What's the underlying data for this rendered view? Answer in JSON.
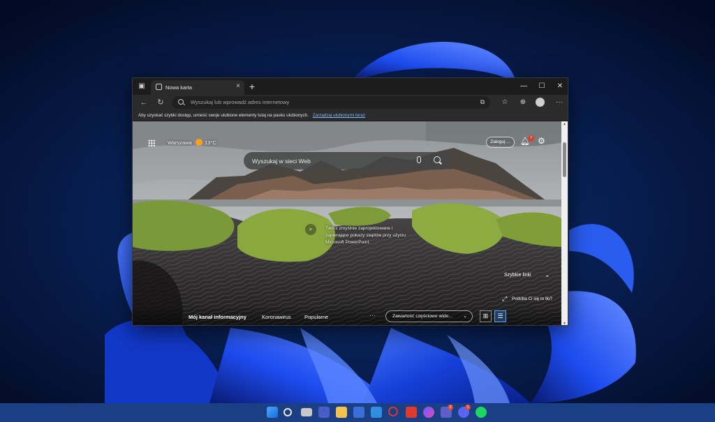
{
  "browser": {
    "tab_title": "Nowa karta",
    "address_placeholder": "Wyszukaj lub wprowadź adres internetowy",
    "favorites_bar": {
      "message": "Aby uzyskać szybki dostęp, umieść swoje ulubione elementy tutaj na pasku ulubionych.",
      "link": "Zarządzaj ulubionymi teraz"
    }
  },
  "new_tab_page": {
    "weather": {
      "city": "Warszawa",
      "temperature": "13°C"
    },
    "login_button": "Zaloguj ...",
    "notifications_count": "7",
    "search_placeholder": "Wyszukaj w sieci Web",
    "info_text": "Twórz zmyślnie zaprojektowane i zapierające pokazy slajdów przy użyciu Microsoft PowerPoint.",
    "quick_links_label": "Szybkie linki",
    "background_question": "Podoba Ci się to tło?",
    "feed_tabs": [
      "Mój kanał informacyjny",
      "Koronawirus",
      "Popularne"
    ],
    "feed_more": "···",
    "content_dropdown": "Zawartość częściowo wido..."
  },
  "taskbar": {
    "badges": {
      "teams": "2",
      "discord": "1"
    }
  },
  "colors": {
    "taskbar": "#1b3f85",
    "accent_link": "#7fb8ff",
    "notification_badge": "#d9412b"
  }
}
